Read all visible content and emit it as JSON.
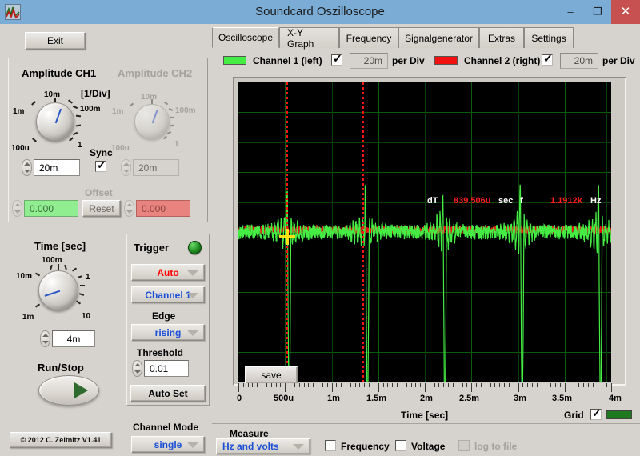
{
  "window": {
    "title": "Soundcard Oszilloscope",
    "app_icon": "waveform-icon",
    "minimize": "–",
    "maximize": "❐",
    "close": "✕"
  },
  "left_panel": {
    "exit_label": "Exit",
    "amplitude": {
      "ch1_title": "Amplitude CH1",
      "ch2_title": "Amplitude CH2",
      "per_div_title": "[1/Div]",
      "knob_ticks": [
        "1m",
        "10m",
        "100m",
        "1",
        "100u"
      ],
      "ch1_value": "20m",
      "ch2_value": "20m",
      "sync_label": "Sync",
      "sync_checked": true,
      "offset_label": "Offset",
      "offset_ch1": "0.000",
      "offset_ch2": "0.000",
      "offset_ch1_color": "#90ee90",
      "offset_ch2_color": "#e8837f",
      "reset_label": "Reset"
    },
    "time": {
      "title": "Time [sec]",
      "knob_ticks": [
        "10m",
        "100m",
        "1",
        "10",
        "1m"
      ],
      "value": "4m",
      "run_stop_label": "Run/Stop"
    },
    "trigger": {
      "title": "Trigger",
      "led_color": "#2f9e2f",
      "mode": "Auto",
      "mode_color": "#ff0000",
      "source": "Channel 1",
      "source_color": "#1a4fd6",
      "edge_label": "Edge",
      "edge": "rising",
      "edge_color": "#1a4fd6",
      "threshold_label": "Threshold",
      "threshold_value": "0.01",
      "auto_set_label": "Auto Set"
    },
    "channel_mode": {
      "label": "Channel Mode",
      "value": "single",
      "value_color": "#1a4fd6"
    },
    "copyright": "© 2012  C. Zeitnitz V1.41"
  },
  "tabs": [
    {
      "label": "Oscilloscope",
      "active": true
    },
    {
      "label": "X-Y Graph",
      "active": false
    },
    {
      "label": "Frequency",
      "active": false
    },
    {
      "label": "Signalgenerator",
      "active": false
    },
    {
      "label": "Extras",
      "active": false
    },
    {
      "label": "Settings",
      "active": false
    }
  ],
  "channel_bar": {
    "ch1_label": "Channel 1 (left)",
    "ch1_color": "#44ec44",
    "ch1_enabled": true,
    "ch1_perdiv_value": "20m",
    "ch1_perdiv_label": "per Div",
    "ch2_label": "Channel 2 (right)",
    "ch2_color": "#f01010",
    "ch2_enabled": true,
    "ch2_perdiv_value": "20m",
    "ch2_perdiv_label": "per Div"
  },
  "scope": {
    "measure_dt_label": "dT",
    "measure_dt_value": "839.506u",
    "measure_dt_unit": "sec",
    "measure_f_label": "f",
    "measure_f_value": "1.1912k",
    "measure_f_unit": "Hz",
    "save_label": "save",
    "x_axis_title": "Time [sec]",
    "grid_label": "Grid",
    "grid_checked": true,
    "grid_color": "#1f7a1f"
  },
  "bottom_bar": {
    "measure_label": "Measure",
    "measure_mode": "Hz and volts",
    "measure_mode_color": "#1a4fd6",
    "frequency_label": "Frequency",
    "frequency_checked": false,
    "voltage_label": "Voltage",
    "voltage_checked": false,
    "log_to_file_label": "log to file",
    "log_to_file_checked": false,
    "log_to_file_enabled": false
  },
  "chart_data": {
    "type": "line",
    "title": "Oscilloscope trace",
    "xlabel": "Time [sec]",
    "ylabel": "",
    "xlim": [
      0,
      0.004
    ],
    "ylim": [
      -0.08,
      0.08
    ],
    "xtick_labels": [
      "0",
      "500u",
      "1m",
      "1.5m",
      "2m",
      "2.5m",
      "3m",
      "3.5m",
      "4m"
    ],
    "xtick_values": [
      0,
      0.0005,
      0.001,
      0.0015,
      0.002,
      0.0025,
      0.003,
      0.0035,
      0.004
    ],
    "grid": true,
    "grid_divisions_x": 8,
    "grid_divisions_y": 10,
    "cursors": {
      "t1": 0.000506,
      "t2": 0.001346,
      "dT": 0.000839506,
      "f": 1191.2
    },
    "series": [
      {
        "name": "Channel 1 (left)",
        "color": "#44ec44",
        "description": "Noisy baseline near 0 V with five large negative spikes (clipped below screen) spaced ~840us apart",
        "spike_times": [
          0.00052,
          0.00136,
          0.00219,
          0.00302,
          0.00386
        ],
        "spike_peak_positive": 0.022,
        "spike_peak_negative": -0.085,
        "baseline_noise_amplitude": 0.004
      },
      {
        "name": "Channel 2 (right)",
        "color": "#f01010",
        "description": "Low amplitude noisy baseline near 0 V, mostly hidden behind Channel 1",
        "baseline_noise_amplitude": 0.002
      }
    ]
  }
}
